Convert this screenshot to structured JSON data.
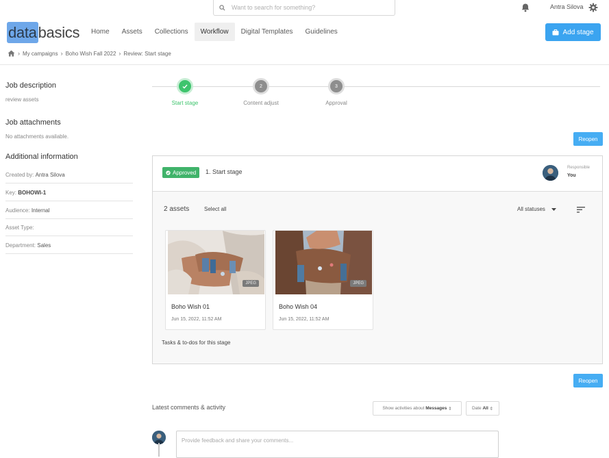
{
  "topbar": {
    "search_placeholder": "Want to search for something?",
    "user_name": "Antra Silova"
  },
  "logo": {
    "highlight": "data",
    "rest": "basics"
  },
  "nav": {
    "items": [
      {
        "label": "Home"
      },
      {
        "label": "Assets"
      },
      {
        "label": "Collections"
      },
      {
        "label": "Workflow"
      },
      {
        "label": "Digital Templates"
      },
      {
        "label": "Guidelines"
      }
    ],
    "active": "Workflow",
    "add_stage_label": "Add stage"
  },
  "breadcrumb": [
    "My campaigns",
    "Boho Wish Fall 2022",
    "Review: Start stage"
  ],
  "sidebar": {
    "job_description_title": "Job description",
    "job_description_value": "review assets",
    "job_attachments_title": "Job attachments",
    "job_attachments_value": "No attachments available.",
    "additional_title": "Additional information",
    "rows": [
      {
        "label": "Created by:",
        "value": "Antra Silova"
      },
      {
        "label": "Key:",
        "value": "BOHOWI-1"
      },
      {
        "label": "Audience:",
        "value": "Internal"
      },
      {
        "label": "Asset Type:",
        "value": ""
      },
      {
        "label": "Department:",
        "value": "Sales"
      }
    ]
  },
  "steps": [
    {
      "number": "",
      "label": "Start stage",
      "status": "done"
    },
    {
      "number": "2",
      "label": "Content adjust",
      "status": "todo"
    },
    {
      "number": "3",
      "label": "Approval",
      "status": "todo"
    }
  ],
  "reopen_label": "Reopen",
  "stage": {
    "badge": "Approved",
    "title": "1. Start stage",
    "responsible_label": "Responsible",
    "responsible_value": "You",
    "asset_count": "2 assets",
    "select_all": "Select all",
    "status_filter": "All statuses",
    "assets": [
      {
        "name": "Boho Wish 01",
        "date": "Jun 15, 2022, 11:52 AM",
        "type": "JPEG"
      },
      {
        "name": "Boho Wish 04",
        "date": "Jun 15, 2022, 11:52 AM",
        "type": "JPEG"
      }
    ],
    "tasks_label": "Tasks & to-dos for this stage"
  },
  "activity": {
    "title": "Latest comments & activity",
    "filter_prefix": "Show activities about",
    "filter_value": "Messages",
    "date_prefix": "Date",
    "date_value": "All",
    "comment_placeholder": "Provide feedback and share your comments..."
  },
  "colors": {
    "accent": "#3ba4f0",
    "success": "#3ec46d",
    "logo_highlight": "#6ea7e9"
  }
}
